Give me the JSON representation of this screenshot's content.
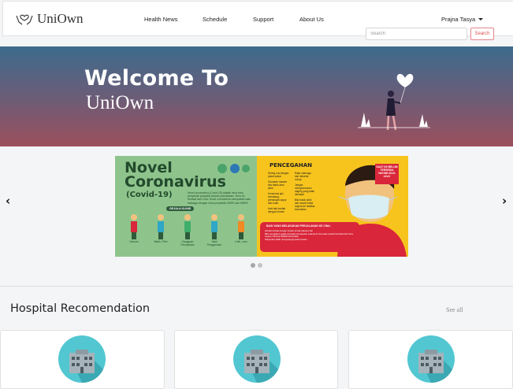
{
  "brand": {
    "name": "UniOwn",
    "logo_icon": "hands-heart-icon"
  },
  "nav": {
    "items": [
      {
        "label": "Health News"
      },
      {
        "label": "Schedule"
      },
      {
        "label": "Support"
      },
      {
        "label": "About Us"
      }
    ],
    "user": {
      "name": "Prajna Tasya"
    }
  },
  "search": {
    "placeholder": "Search",
    "button_label": "Search"
  },
  "hero": {
    "title": "Welcome To",
    "subtitle": "UniOwn"
  },
  "carousel": {
    "prev_label": "‹",
    "next_label": "›",
    "slide": {
      "title_line1": "Novel",
      "title_line2": "Coronavirus",
      "title_line3": "(Covid-19)",
      "intro": "Novel coronavirus (Covid-19) adalah virus baru penyebab penyakit saluran pernafasan. Virus ini berasal dari Cina. Novel coronavirus merupakan satu keluarga dengan virus penyebab SARS dan MERS",
      "gejala": "GEJALA KLINIS",
      "symptoms": [
        "Demam",
        "Batuk, Pilek",
        "Gangguan Pernapasan",
        "Sakit Tenggorokan",
        "Letih, Lesu"
      ],
      "prevention_title": "PENCEGAHAN",
      "prevention_left": [
        "Sering cuci tangan pakai sabun",
        "Gunakan masker bila batuk atau pilek",
        "Konsumsi gizi seimbang, perbanyak sayur dan buah",
        "Hati-hati kontak dengan hewan"
      ],
      "prevention_right": [
        "Rajin olahraga dan istirahat cukup",
        "Jangan mengkonsumsi daging yang tidak dimasak",
        "Bila batuk pilek dan sesak nafas segera ke fasilitas kesehatan"
      ],
      "travel_title": "BAGI YANG MELAKUKAN PERJALANAN KE CINA:",
      "travel_items": [
        "Hindari kontak dengan hewan ternak ataupun liar",
        "Bila mengalami gejala penyakit pernapasan selama di Cina atau setelah kembali dari Cina, segera hubungi fasilitas kesehatan",
        "Dianjurkan tidak mengunjungi pasar hewan"
      ],
      "vaksin_badge": "SAAT INI BELUM TERSEDIA VAKSIN 2019-nCoV"
    },
    "indicator_count": 2,
    "active_index": 0
  },
  "section": {
    "title": "Hospital Recomendation",
    "see_all": "See all"
  },
  "cards": [
    {
      "icon": "hospital-building-icon"
    },
    {
      "icon": "hospital-building-icon"
    },
    {
      "icon": "hospital-building-icon"
    }
  ],
  "colors": {
    "accent_red": "#d9534f",
    "hero_top": "#3d6b8d",
    "hero_bottom": "#9c4f5c",
    "card_icon_bg": "#52c7d1"
  }
}
